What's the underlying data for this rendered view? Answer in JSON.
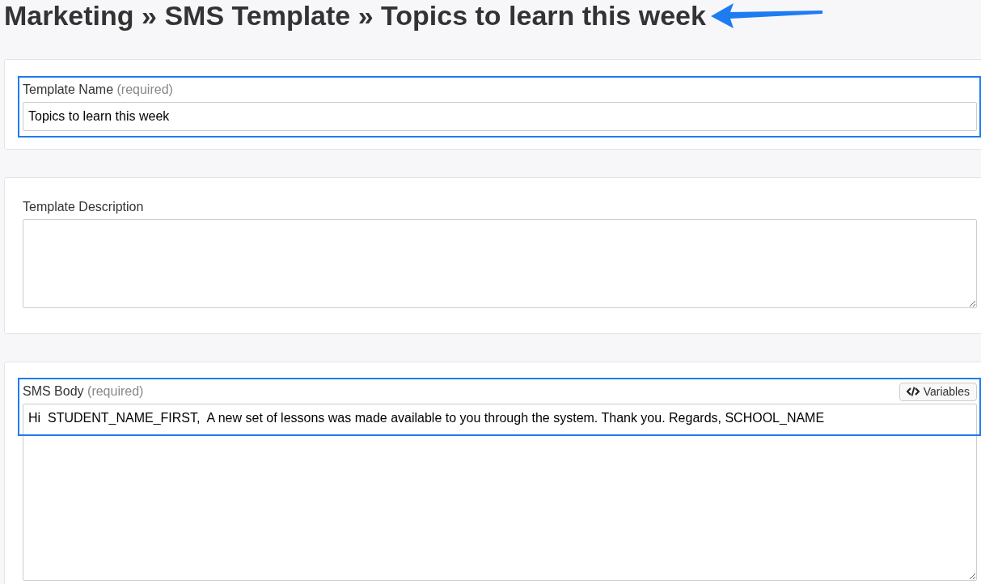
{
  "page_title": "Marketing » SMS Template » Topics to learn this week",
  "sections": [
    {
      "kind": "input",
      "label": "Template Name",
      "hint": "(required)",
      "value": "Topics to learn this week",
      "highlighted": true
    },
    {
      "kind": "textarea",
      "label": "Template Description",
      "highlighted": false
    },
    {
      "kind": "textarea",
      "label": "SMS Body",
      "hint": "(required)",
      "value": "Hi  STUDENT_NAME_FIRST,  A new set of lessons was made available to you through the system. Thank you. Regards, SCHOOL_NAME",
      "highlighted": true,
      "action": "Variables"
    }
  ]
}
